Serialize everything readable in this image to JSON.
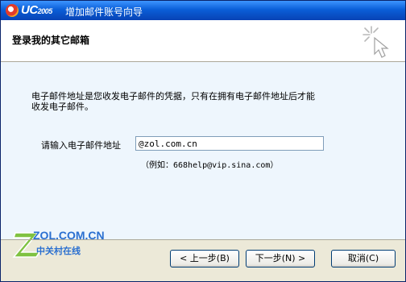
{
  "titlebar": {
    "app_name": "UC",
    "app_version": "2005",
    "title": "增加邮件账号向导"
  },
  "header": {
    "title": "登录我的其它邮箱"
  },
  "content": {
    "description": "电子邮件地址是您收发电子邮件的凭据，只有在拥有电子邮件地址后才能收发电子邮件。",
    "email_label": "请输入电子邮件地址",
    "email_value": "@zol.com.cn",
    "hint_prefix": "（例如：",
    "hint_example": "668help@vip.sina.com",
    "hint_suffix": "）"
  },
  "watermark": {
    "logo_text": "ZOL.COM.CN",
    "logo_sub": "中关村在线"
  },
  "buttons": {
    "back": "< 上一步(B)",
    "next": "下一步(N) >",
    "cancel": "取消(C)"
  }
}
